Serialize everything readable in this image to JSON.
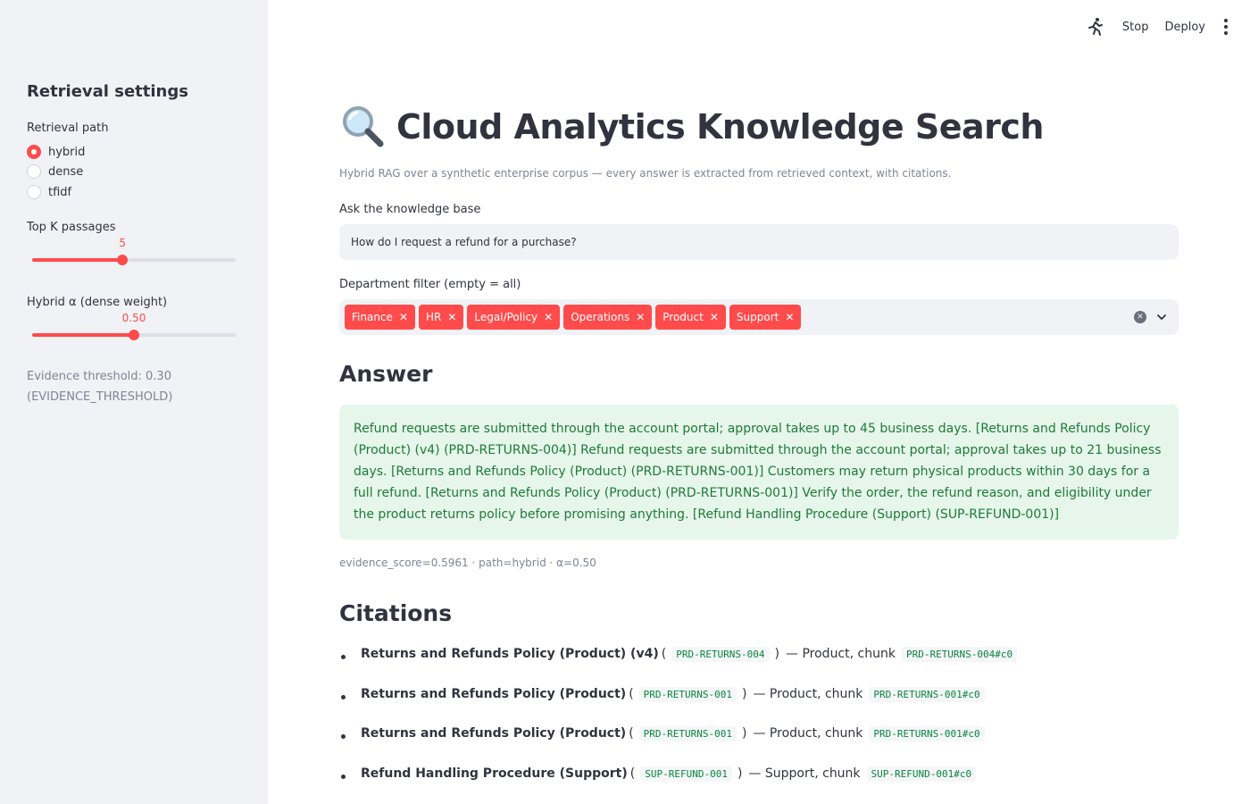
{
  "sidebar": {
    "title": "Retrieval settings",
    "retrieval_path_label": "Retrieval path",
    "options": [
      "hybrid",
      "dense",
      "tfidf"
    ],
    "selected": "hybrid",
    "topk_label": "Top K passages",
    "topk_value": "5",
    "topk_fraction": 0.444,
    "alpha_label": "Hybrid α (dense weight)",
    "alpha_value": "0.50",
    "alpha_fraction": 0.5,
    "evidence_line1": "Evidence threshold: 0.30",
    "evidence_line2": "(EVIDENCE_THRESHOLD)"
  },
  "topbar": {
    "stop_label": "Stop",
    "deploy_label": "Deploy"
  },
  "main": {
    "title": "Cloud Analytics Knowledge Search",
    "subtitle": "Hybrid RAG over a synthetic enterprise corpus — every answer is extracted from retrieved context, with citations.",
    "query_label": "Ask the knowledge base",
    "query_value": "How do I request a refund for a purchase?",
    "dept_label": "Department filter (empty = all)",
    "departments": [
      "Finance",
      "HR",
      "Legal/Policy",
      "Operations",
      "Product",
      "Support"
    ],
    "answer_heading": "Answer",
    "answer_text": "Refund requests are submitted through the account portal; approval takes up to 45 business days. [Returns and Refunds Policy (Product) (v4) (PRD-RETURNS-004)] Refund requests are submitted through the account portal; approval takes up to 21 business days. [Returns and Refunds Policy (Product) (PRD-RETURNS-001)] Customers may return physical products within 30 days for a full refund. [Returns and Refunds Policy (Product) (PRD-RETURNS-001)] Verify the order, the refund reason, and eligibility under the product returns policy before promising anything. [Refund Handling Procedure (Support) (SUP-REFUND-001)]",
    "score_line": "evidence_score=0.5961 · path=hybrid · α=0.50",
    "citations_heading": "Citations",
    "citations": [
      {
        "title": "Returns and Refunds Policy (Product) (v4)",
        "doc_id": "PRD-RETURNS-004",
        "dept": "— Product, chunk",
        "chunk": "PRD-RETURNS-004#c0"
      },
      {
        "title": "Returns and Refunds Policy (Product)",
        "doc_id": "PRD-RETURNS-001",
        "dept": "— Product, chunk",
        "chunk": "PRD-RETURNS-001#c0"
      },
      {
        "title": "Returns and Refunds Policy (Product)",
        "doc_id": "PRD-RETURNS-001",
        "dept": "— Product, chunk",
        "chunk": "PRD-RETURNS-001#c0"
      },
      {
        "title": "Refund Handling Procedure (Support)",
        "doc_id": "SUP-REFUND-001",
        "dept": "— Support, chunk",
        "chunk": "SUP-REFUND-001#c0"
      }
    ]
  },
  "colors": {
    "accent": "#ff4b4b",
    "sidebar_bg": "#f0f2f6",
    "success_bg": "#e6f6ea",
    "success_text": "#1f7a3a"
  },
  "icons": {
    "title": "magnifier-icon",
    "running": "running-man-icon",
    "menu": "kebab-menu-icon"
  }
}
